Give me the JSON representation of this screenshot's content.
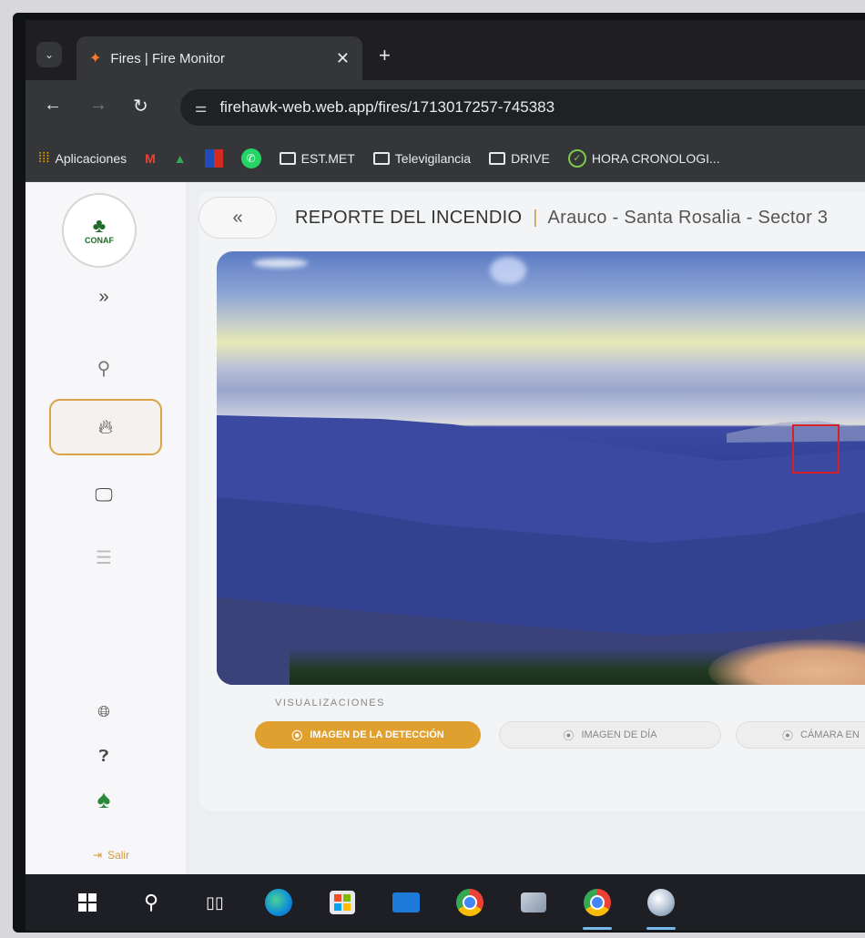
{
  "browser": {
    "tab": {
      "title": "Fires | Fire Monitor",
      "favicon": "fire-hawk-icon"
    },
    "url": "firehawk-web.web.app/fires/1713017257-745383",
    "bookmarks": [
      {
        "label": "Aplicaciones",
        "icon": "apps-grid-icon"
      },
      {
        "label": "",
        "icon": "gmail-icon"
      },
      {
        "label": "",
        "icon": "google-drive-icon"
      },
      {
        "label": "",
        "icon": "flag-icon"
      },
      {
        "label": "",
        "icon": "whatsapp-icon"
      },
      {
        "label": "EST.MET",
        "icon": "folder-icon"
      },
      {
        "label": "Televigilancia",
        "icon": "folder-icon"
      },
      {
        "label": "DRIVE",
        "icon": "folder-icon"
      },
      {
        "label": "HORA CRONOLOGI...",
        "icon": "check-circle-icon"
      }
    ]
  },
  "sidebar": {
    "logo_text": "CONAF",
    "logout_label": "Salir"
  },
  "header": {
    "back_label": "«",
    "title": "REPORTE DEL INCENDIO",
    "separator": "|",
    "location": "Arauco - Santa Rosalia - Sector 3"
  },
  "visualizaciones": {
    "label": "VISUALIZACIONES",
    "buttons": [
      {
        "label": "IMAGEN DE LA DETECCIÓN",
        "active": true
      },
      {
        "label": "IMAGEN DE DÍA",
        "active": false
      },
      {
        "label": "CÁMARA EN",
        "active": false
      }
    ]
  },
  "colors": {
    "accent": "#e0a030",
    "detection_box": "#d3202a"
  }
}
